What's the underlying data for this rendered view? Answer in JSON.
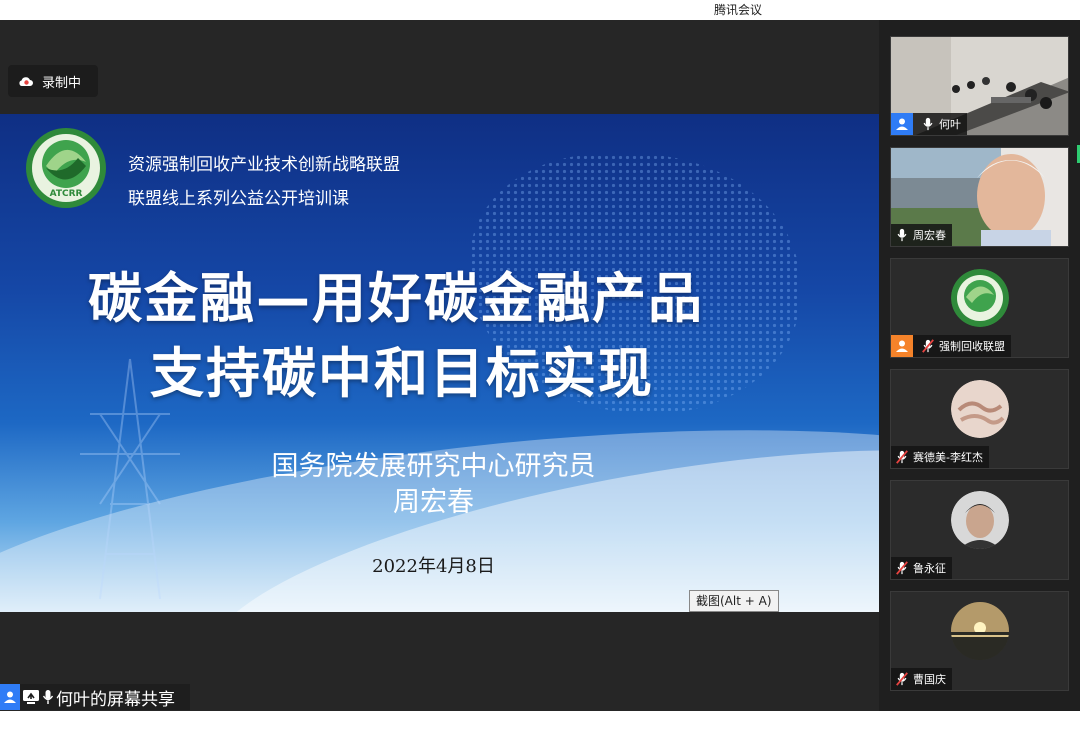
{
  "window": {
    "title": "腾讯会议"
  },
  "recording": {
    "label": "录制中"
  },
  "slide": {
    "org_line1": "资源强制回收产业技术创新战略联盟",
    "org_line2": "联盟线上系列公益公开培训课",
    "headline_line1": "碳金融—用好碳金融产品",
    "headline_line2": "支持碳中和目标实现",
    "author_title": "国务院发展研究中心研究员",
    "author_name": "周宏春",
    "date": "2022年4月8日",
    "logo_text": "ATCRR"
  },
  "tooltip": {
    "screenshot_hint": "截图(Alt + A)"
  },
  "share": {
    "label": "何叶的屏幕共享"
  },
  "participants": [
    {
      "name": "何叶",
      "mic": "on",
      "badge": "user-blue"
    },
    {
      "name": "周宏春",
      "mic": "on",
      "badge": "none"
    },
    {
      "name": "强制回收联盟",
      "mic": "muted",
      "badge": "user-orange"
    },
    {
      "name": "赛德美-李红杰",
      "mic": "muted",
      "badge": "none"
    },
    {
      "name": "鲁永征",
      "mic": "muted",
      "badge": "none"
    },
    {
      "name": "曹国庆",
      "mic": "muted",
      "badge": "none"
    }
  ],
  "colors": {
    "accent_blue": "#2f7cf6",
    "accent_orange": "#f5832a",
    "muted_red": "#e64340",
    "active_green": "#2ecc71"
  }
}
